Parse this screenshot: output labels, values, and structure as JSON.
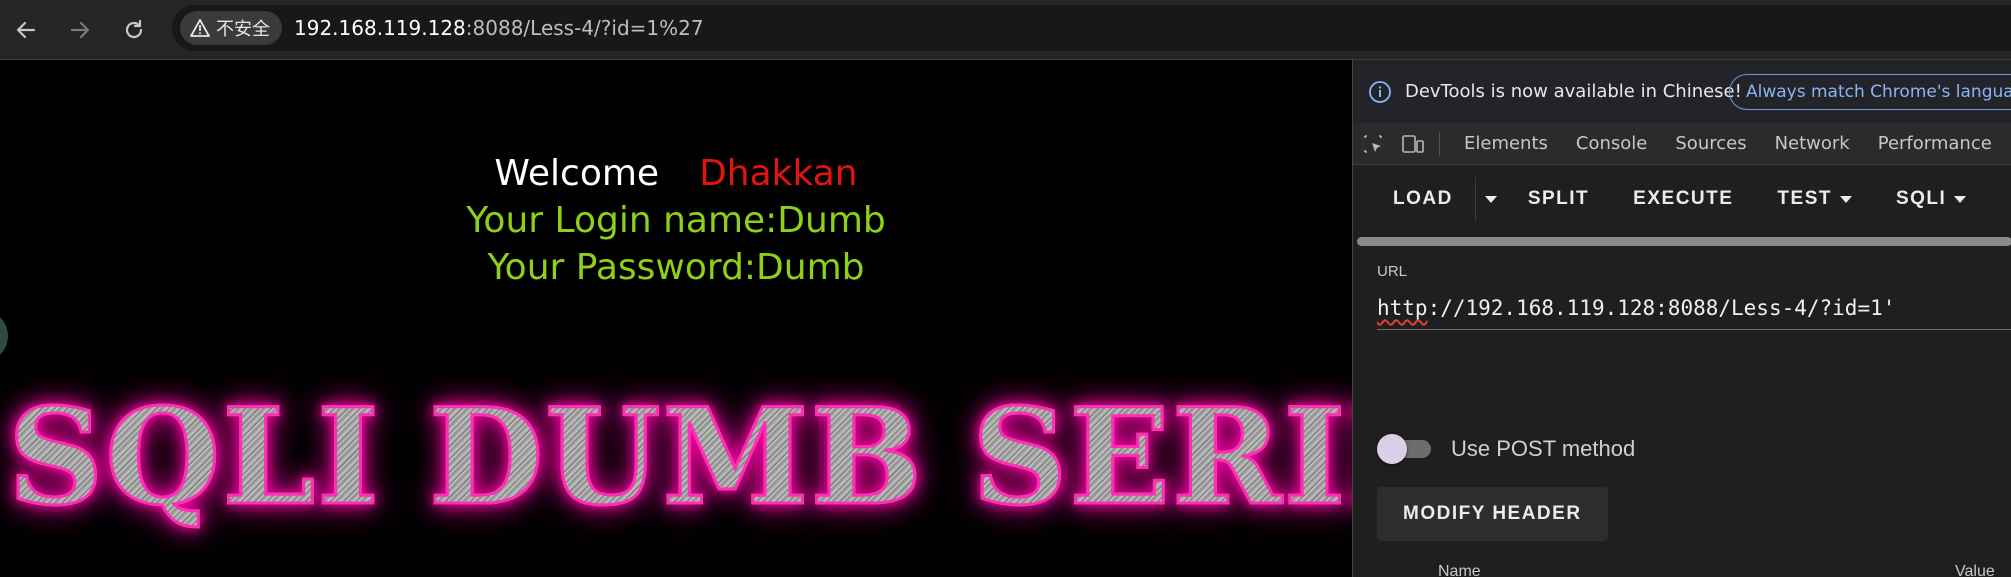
{
  "browser": {
    "security_label": "不安全",
    "url_host": "192.168.119.128",
    "url_path": ":8088/Less-4/?id=1%27"
  },
  "page": {
    "welcome_label": "Welcome",
    "welcome_name": "Dhakkan",
    "login_line": "Your Login name:Dumb",
    "password_line": "Your Password:Dumb",
    "banner_text": "SQLI DUMB SERIES"
  },
  "devtools": {
    "notice_text": "DevTools is now available in Chinese!",
    "notice_button": "Always match Chrome's language",
    "tabs": [
      "Elements",
      "Console",
      "Sources",
      "Network",
      "Performance"
    ],
    "hackbar": {
      "load": "LOAD",
      "split": "SPLIT",
      "execute": "EXECUTE",
      "test": "TEST",
      "sqli": "SQLI",
      "url_label": "URL",
      "url_value_prefix": "http",
      "url_value_rest": "://192.168.119.128:8088/Less-4/?id=1'",
      "post_label": "Use POST method",
      "modify_header": "MODIFY HEADER",
      "col_name": "Name",
      "col_value": "Value"
    }
  }
}
